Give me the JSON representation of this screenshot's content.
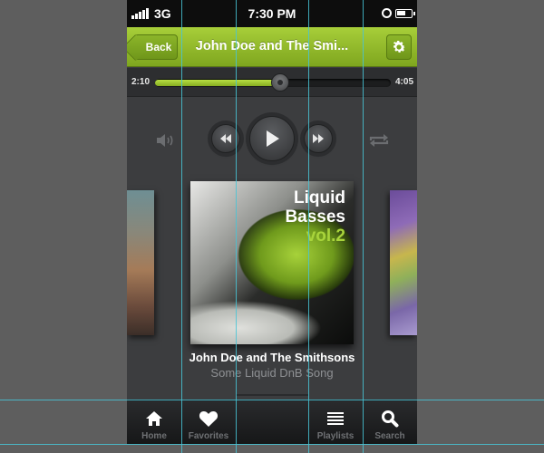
{
  "status_bar": {
    "carrier": "3G",
    "time": "7:30 PM",
    "icons": [
      "signal-icon",
      "alarm-icon",
      "battery-icon"
    ]
  },
  "navbar": {
    "back_label": "Back",
    "title": "John Doe and The Smi...",
    "settings_icon": "gear-icon",
    "color": "#8fb82b"
  },
  "player": {
    "elapsed": "2:10",
    "total": "4:05",
    "progress_fraction": 0.53,
    "icons": [
      "volume-icon",
      "rewind-icon",
      "play-icon",
      "fast-forward-icon",
      "repeat-icon"
    ]
  },
  "now_playing": {
    "art_line1": "Liquid",
    "art_line2": "Basses",
    "art_line3": "vol.2",
    "artist": "John Doe and The Smithsons",
    "song": "Some Liquid DnB Song",
    "accent_color": "#a8d43b"
  },
  "tabbar": {
    "tabs": [
      {
        "label": "Home",
        "icon": "home-icon"
      },
      {
        "label": "Favorites",
        "icon": "heart-icon"
      },
      {
        "label": "Playlists",
        "icon": "list-icon"
      },
      {
        "label": "Search",
        "icon": "search-icon"
      }
    ]
  }
}
